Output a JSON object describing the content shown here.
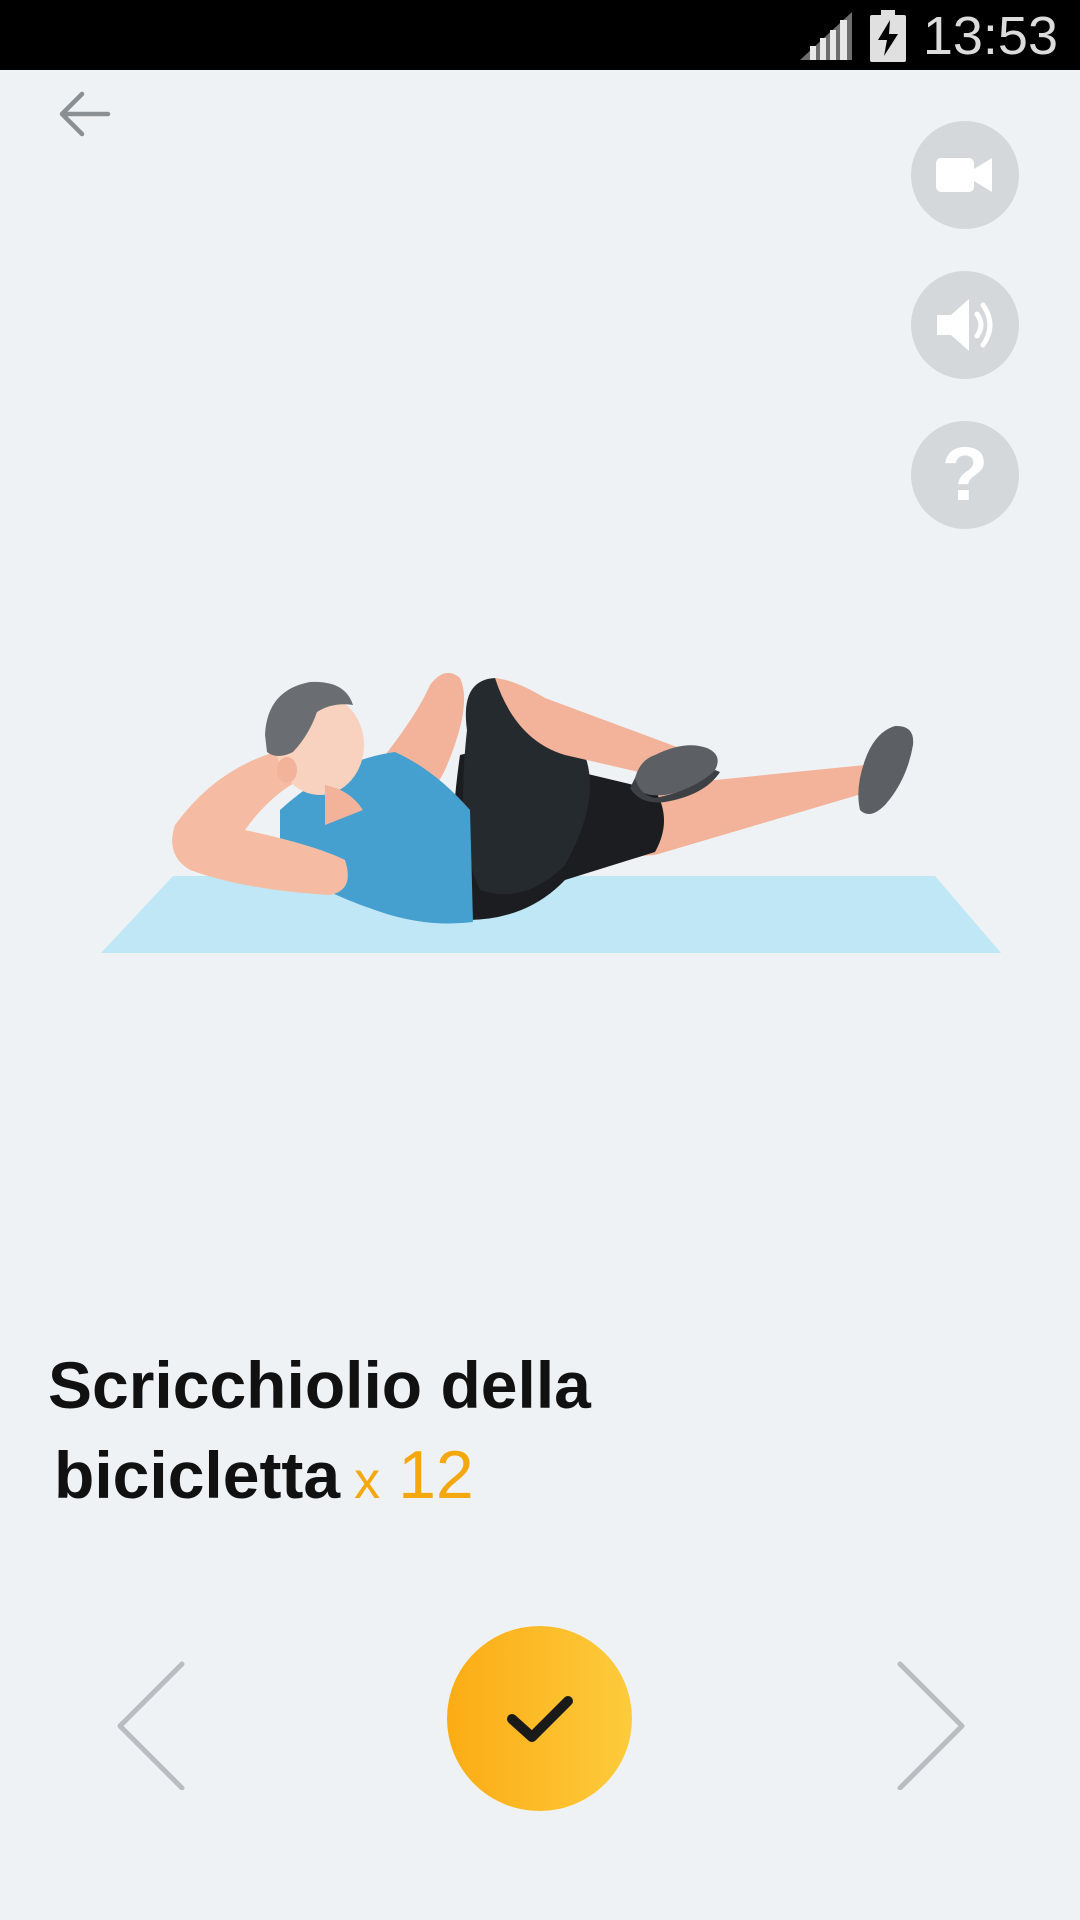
{
  "status_bar": {
    "time": "13:53"
  },
  "exercise": {
    "name_line1": "Scricchiolio della",
    "name_line2": "bicicletta",
    "reps_prefix": "x",
    "reps": "12"
  },
  "icons": {
    "back": "arrow-left-icon",
    "video": "video-camera-icon",
    "sound": "speaker-icon",
    "help": "question-icon",
    "prev": "chevron-left-icon",
    "next": "chevron-right-icon",
    "done": "checkmark-icon"
  },
  "help_glyph": "?",
  "colors": {
    "accent": "#f4a80f",
    "background": "#eff2f4",
    "round_button": "#d5d8db"
  }
}
